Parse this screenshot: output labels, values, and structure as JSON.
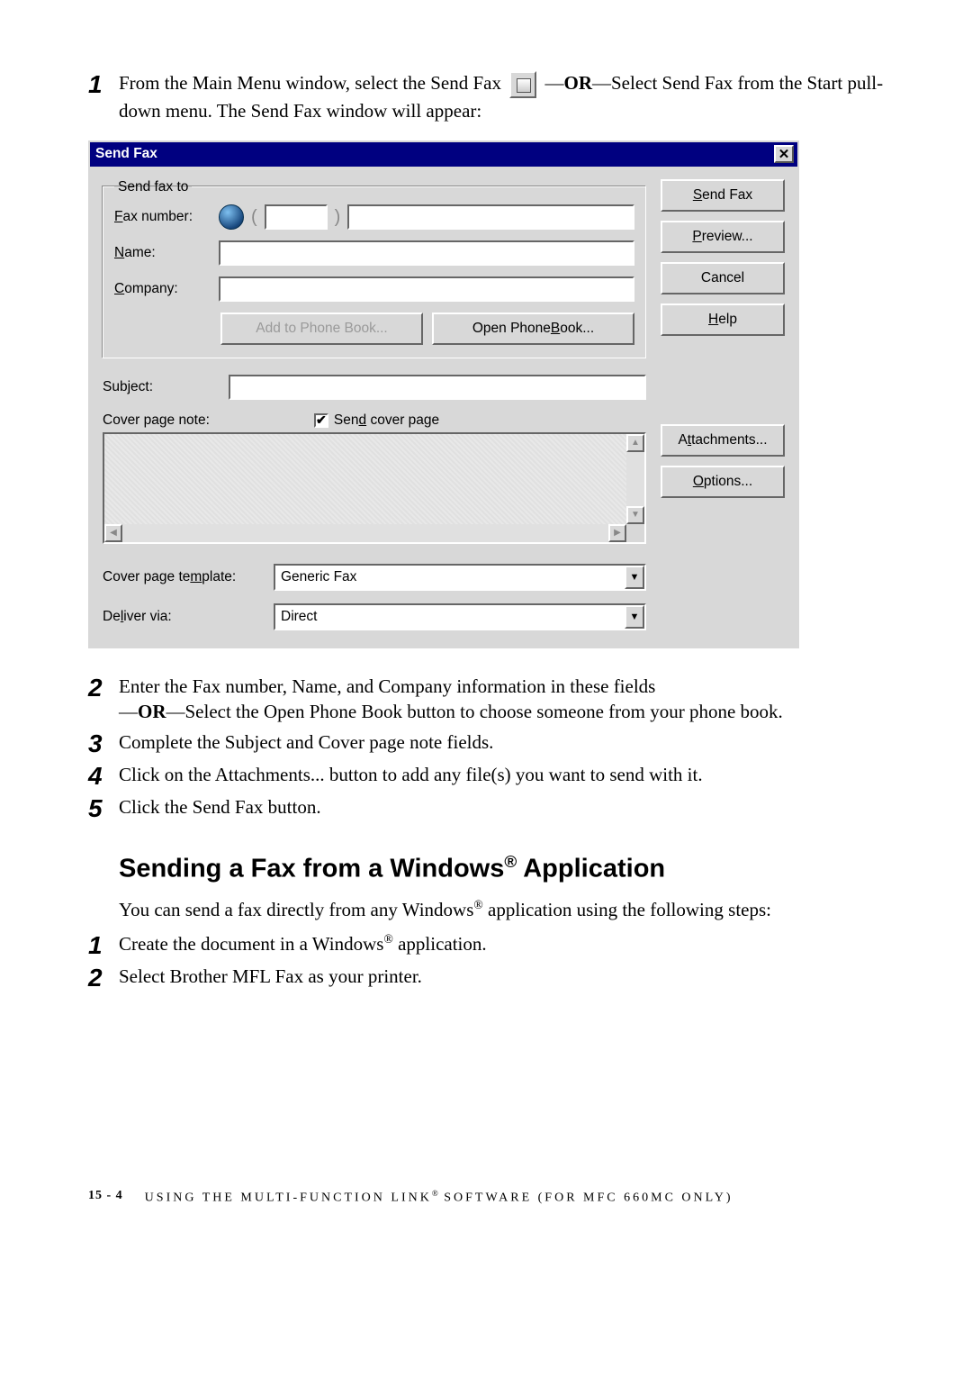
{
  "steps_a": [
    {
      "num": "1",
      "textA": "From the Main Menu window, select the Send Fax ",
      "textB": " —",
      "or": "OR",
      "textC": "—Select Send Fax from the Start pull-down menu.  The Send Fax window will appear:"
    }
  ],
  "dialog": {
    "title": "Send Fax",
    "sendto_legend": "Send fax to",
    "fax_label": "Fax number:",
    "name_label": "Name:",
    "company_label": "Company:",
    "add_pb": "Add to Phone Book...",
    "open_pb": "Open Phone Book...",
    "subject_label": "Subject:",
    "cpn_label": "Cover page note:",
    "send_cover": "Send cover page",
    "send_cover_checked": "✔",
    "cpt_label": "Cover page template:",
    "cpt_value": "Generic Fax",
    "deliver_label": "Deliver via:",
    "deliver_value": "Direct",
    "buttons": {
      "send": "Send Fax",
      "preview": "Preview...",
      "cancel": "Cancel",
      "help": "Help",
      "attach": "Attachments...",
      "options": "Options..."
    }
  },
  "steps_b": [
    {
      "num": "2",
      "line1": "Enter the Fax number, Name, and Company information in these fields",
      "line2a": "—",
      "or": "OR",
      "line2b": "—Select the Open Phone Book button to choose someone from your phone book."
    },
    {
      "num": "3",
      "line1": "Complete the Subject and Cover page note fields."
    },
    {
      "num": "4",
      "line1": "Click on the Attachments... button to add any file(s) you want to send with it."
    },
    {
      "num": "5",
      "line1": "Click the Send Fax button."
    }
  ],
  "heading2": {
    "a": "Sending a Fax from a Windows",
    "sup": "®",
    "b": " Application"
  },
  "body2": {
    "a": "You can send a fax directly from any Windows",
    "sup": "®",
    "b": " application using the following steps:"
  },
  "steps_c": [
    {
      "num": "1",
      "line1a": "Create the document in a Windows",
      "sup": "®",
      "line1b": " application."
    },
    {
      "num": "2",
      "line1": "Select Brother MFL Fax as your printer."
    }
  ],
  "footer": {
    "page": "15 - 4",
    "text_a": "USING THE MULTI-FUNCTION LINK",
    "sup": "®",
    "text_b": " SOFTWARE (FOR MFC 660MC ONLY)"
  }
}
